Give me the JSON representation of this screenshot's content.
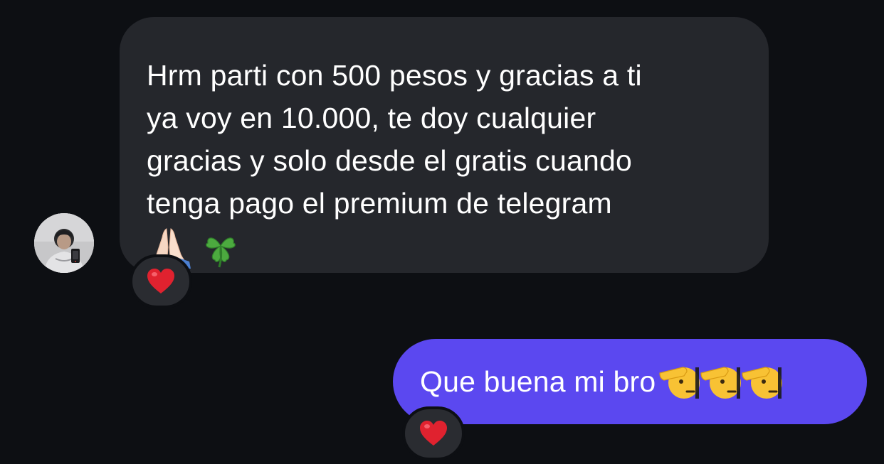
{
  "conversation": {
    "incoming": {
      "text": "Hrm parti con 500 pesos y gracias a ti\nya voy en 10.000, te doy cualquier\ngracias y solo desde el gratis cuando\ntenga pago el premium de telegram",
      "emojis": [
        "folded-hands",
        "four-leaf-clover"
      ],
      "reaction": "heart"
    },
    "outgoing": {
      "text": "Que buena mi bro",
      "emojis": [
        "saluting-face",
        "saluting-face",
        "saluting-face"
      ],
      "reaction": "heart"
    }
  },
  "colors": {
    "background": "#0d0f13",
    "incoming_bubble": "#25272c",
    "outgoing_bubble": "#5b48f0",
    "text": "#ffffff",
    "reaction_bg": "#2a2c31"
  }
}
